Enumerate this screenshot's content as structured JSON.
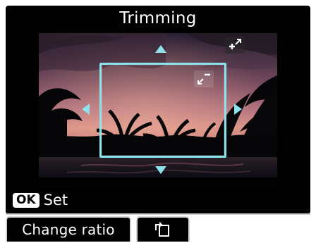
{
  "screen": {
    "title": "Trimming"
  },
  "controls": {
    "ok_key_label": "OK",
    "ok_action_label": "Set"
  },
  "softkeys": {
    "change_ratio_label": "Change ratio",
    "rotate_icon": "rotate-frame-icon"
  },
  "icons": {
    "zoom_in": "zoom-in-expand-icon",
    "zoom_out": "zoom-out-shrink-icon",
    "arrow_up": "arrow-up-icon",
    "arrow_down": "arrow-down-icon",
    "arrow_left": "arrow-left-icon",
    "arrow_right": "arrow-right-icon"
  },
  "colors": {
    "accent": "#8ce3eb",
    "panel": "#000000",
    "text": "#ffffff",
    "softkey_border": "#d6d6d6"
  }
}
